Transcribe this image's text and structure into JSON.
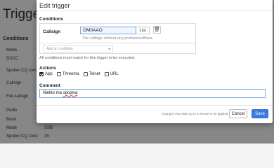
{
  "background": {
    "title": "Triggers",
    "header": "Conditions",
    "rows": [
      {
        "label": "Mode",
        "value": ""
      },
      {
        "label": "DXCC",
        "value": ""
      },
      {
        "label": "Spotter CQ zone",
        "value": ""
      },
      {
        "label": "Callsign",
        "value": ""
      },
      {
        "label": "Full callsign",
        "value": ""
      },
      {
        "label": "Prefix",
        "value": ""
      },
      {
        "label": "Band",
        "value": ""
      },
      {
        "label": "Mode",
        "value": "SSB"
      },
      {
        "label": "Spotter CQ zone",
        "value": "15"
      }
    ]
  },
  "modal": {
    "title": "Edit trigger",
    "conditions": {
      "heading": "Conditions",
      "rows": [
        {
          "label": "Callsign",
          "value": "OM0AAO",
          "list_label": "List",
          "help": "The callsign without any prefixes/suffixes."
        }
      ],
      "add_placeholder": "Add a condition",
      "note": "All conditions must match for this trigger to be executed."
    },
    "actions": {
      "heading": "Actions",
      "items": [
        {
          "label": "App",
          "checked": true
        },
        {
          "label": "Threema",
          "checked": false
        },
        {
          "label": "Telnet",
          "checked": false
        },
        {
          "label": "URL",
          "checked": false
        }
      ]
    },
    "comment": {
      "heading": "Comment",
      "value_plain": "Niekto ma ",
      "value_misspelled": "spojova"
    },
    "footer": {
      "note": "Changes may take up to a minute to be applied.",
      "cancel_label": "Cancel",
      "save_label": "Save"
    }
  }
}
